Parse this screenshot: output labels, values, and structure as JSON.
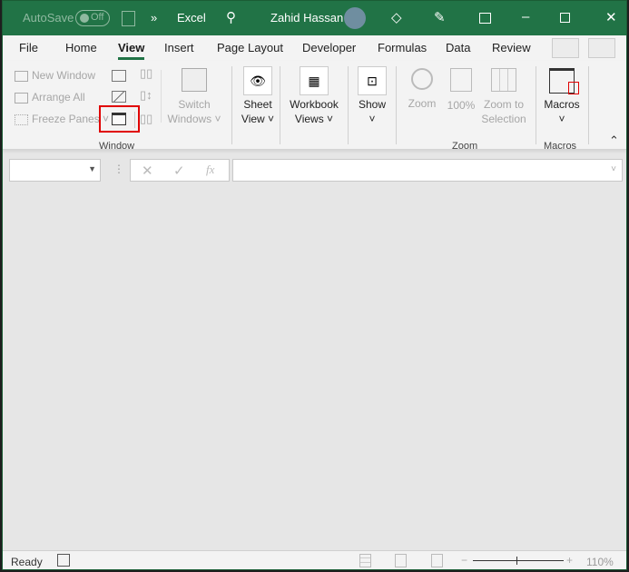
{
  "titlebar": {
    "autosave_label": "AutoSave",
    "autosave_state": "Off",
    "app_name": "Excel",
    "user_name": "Zahid Hassan",
    "brand_color": "#217346"
  },
  "tabs": [
    {
      "label": "File"
    },
    {
      "label": "Home"
    },
    {
      "label": "View",
      "active": true
    },
    {
      "label": "Insert"
    },
    {
      "label": "Page Layout"
    },
    {
      "label": "Developer"
    },
    {
      "label": "Formulas"
    },
    {
      "label": "Data"
    },
    {
      "label": "Review"
    }
  ],
  "ribbon": {
    "window": {
      "new_window": "New Window",
      "arrange_all": "Arrange All",
      "freeze_panes": "Freeze Panes",
      "switch_line1": "Switch",
      "switch_line2": "Windows",
      "group": "Window"
    },
    "sheet_view": {
      "line1": "Sheet",
      "line2": "View"
    },
    "workbook_views": {
      "line1": "Workbook",
      "line2": "Views"
    },
    "show": {
      "label": "Show"
    },
    "zoom": {
      "zoom": "Zoom",
      "hundred": "100%",
      "zts_line1": "Zoom to",
      "zts_line2": "Selection",
      "group": "Zoom"
    },
    "macros": {
      "label": "Macros",
      "group": "Macros"
    },
    "highlight_color": "#e00000"
  },
  "formula_bar": {
    "name_box": "",
    "fx": "fx",
    "formula": ""
  },
  "status": {
    "ready": "Ready",
    "zoom_level": "110%"
  }
}
